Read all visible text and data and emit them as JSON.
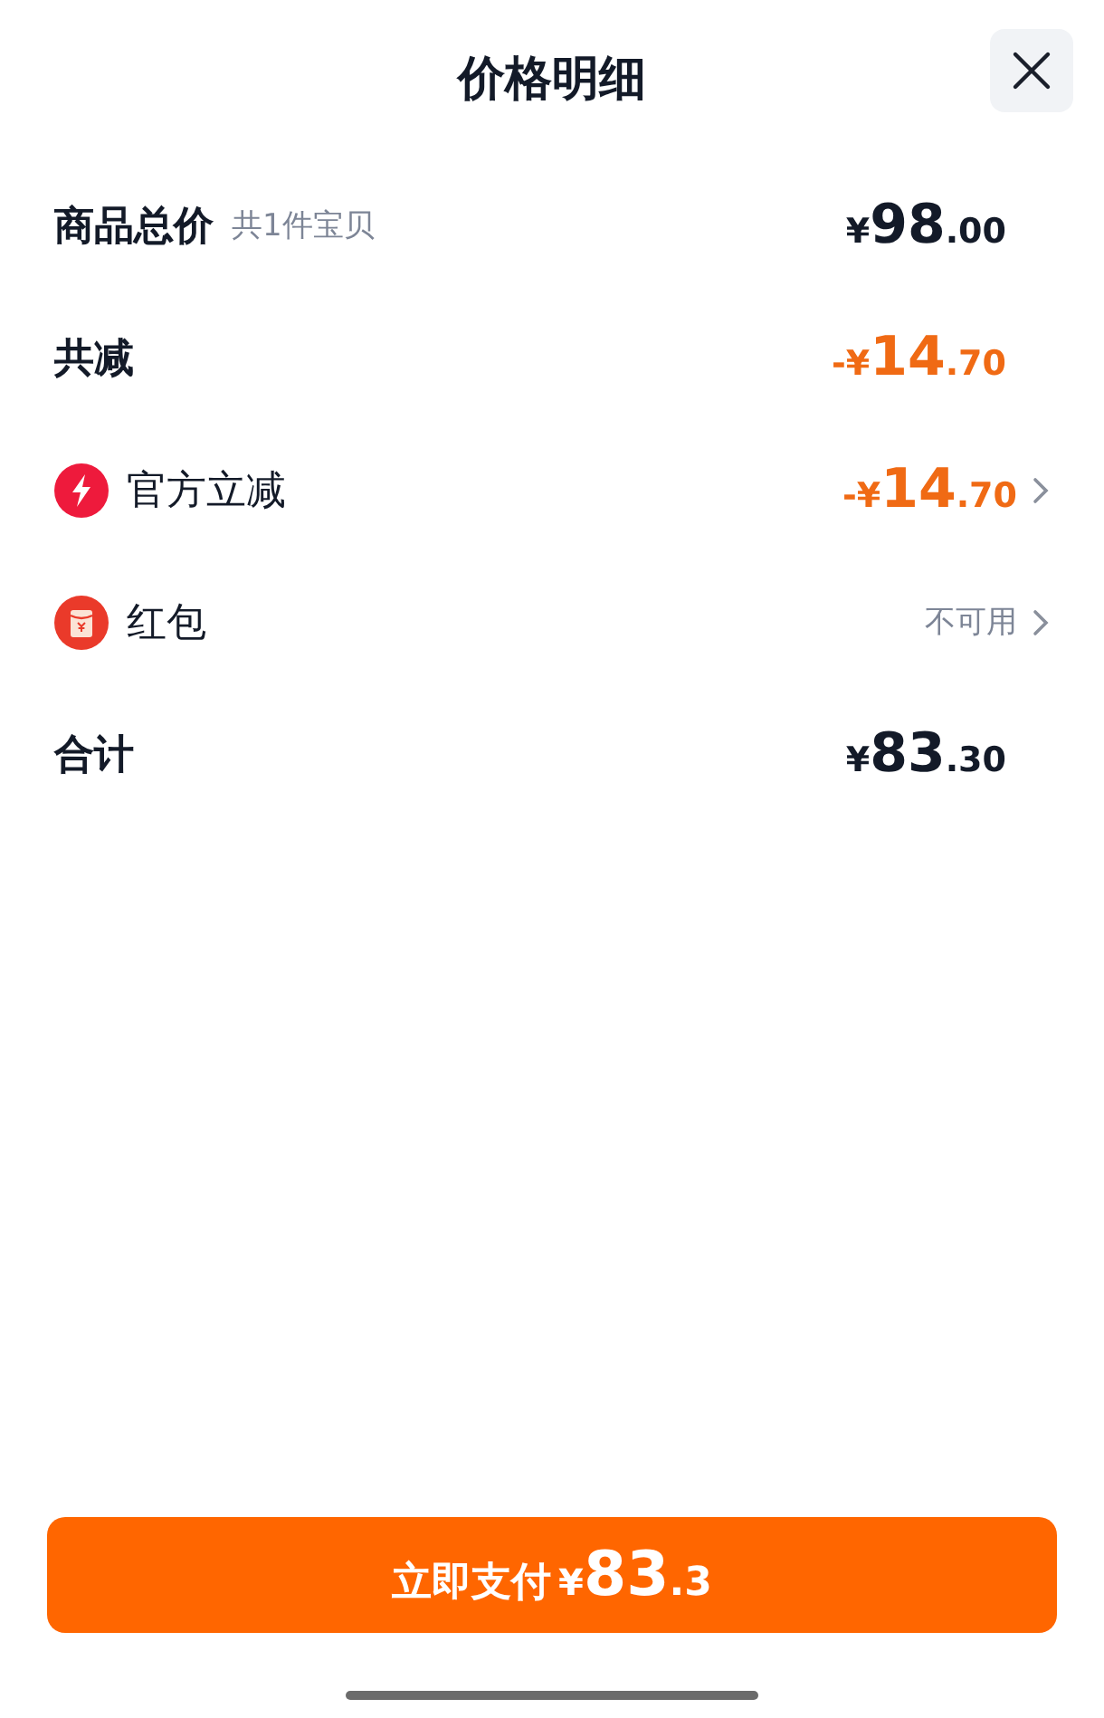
{
  "title": "价格明细",
  "rows": [
    {
      "kind": "plain",
      "label": "商品总价",
      "note": "共1件宝贝",
      "price": {
        "prefix": "¥",
        "integer": "98",
        "decimal": ".00",
        "highlight": false
      },
      "chevron": false
    },
    {
      "kind": "plain",
      "label": "共减",
      "price": {
        "prefix": "-¥",
        "integer": "14",
        "decimal": ".70",
        "highlight": true
      },
      "chevron": false
    },
    {
      "kind": "offer",
      "label": "官方立减",
      "price": {
        "prefix": "-¥",
        "integer": "14",
        "decimal": ".70",
        "highlight": true
      },
      "chevron": true
    },
    {
      "kind": "coupon",
      "label": "红包",
      "status": "不可用",
      "chevron": true
    },
    {
      "kind": "plain",
      "label": "合计",
      "price": {
        "prefix": "¥",
        "integer": "83",
        "decimal": ".30",
        "highlight": false
      },
      "chevron": false
    }
  ],
  "pay_button": {
    "label": "立即支付",
    "prefix": "¥",
    "integer": "83",
    "decimal": ".3"
  }
}
